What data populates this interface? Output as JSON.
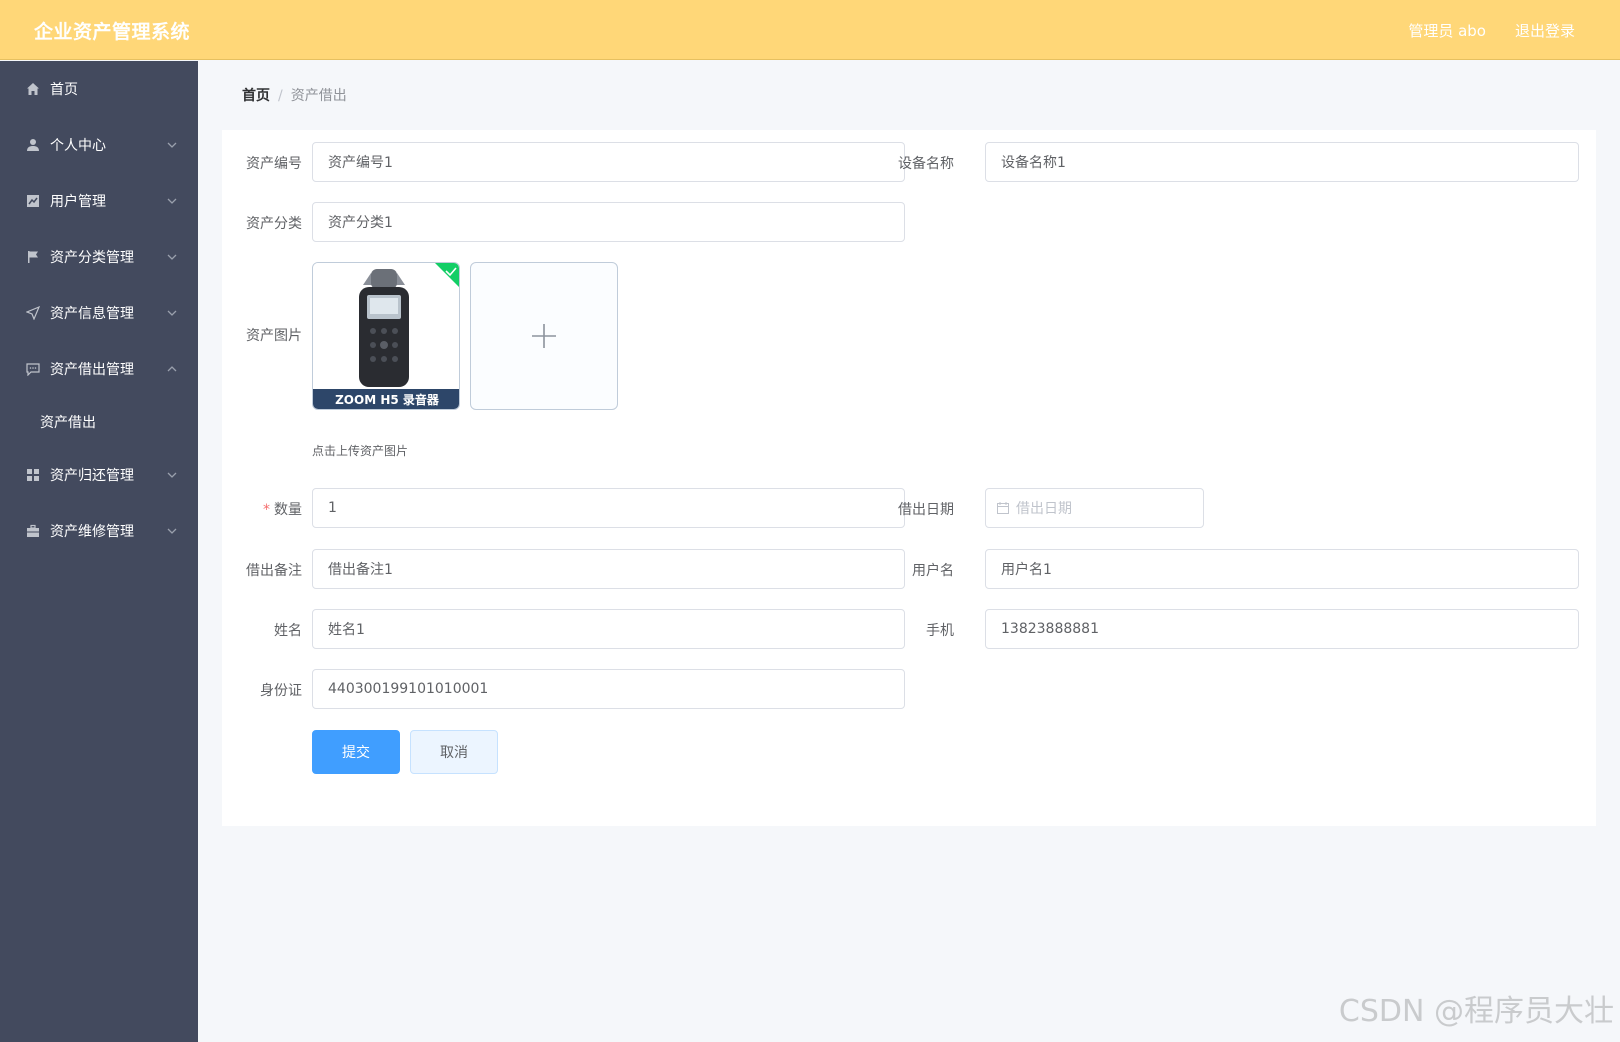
{
  "header": {
    "title": "企业资产管理系统",
    "user": "管理员 abo",
    "logout": "退出登录"
  },
  "sidebar": {
    "items": [
      {
        "label": "首页",
        "icon": "home-icon",
        "expandable": false
      },
      {
        "label": "个人中心",
        "icon": "user-icon",
        "expandable": true
      },
      {
        "label": "用户管理",
        "icon": "chart-icon",
        "expandable": true
      },
      {
        "label": "资产分类管理",
        "icon": "flag-icon",
        "expandable": true
      },
      {
        "label": "资产信息管理",
        "icon": "send-icon",
        "expandable": true
      },
      {
        "label": "资产借出管理",
        "icon": "message-icon",
        "expandable": true,
        "expanded": true
      },
      {
        "label": "资产归还管理",
        "icon": "grid-icon",
        "expandable": true
      },
      {
        "label": "资产维修管理",
        "icon": "briefcase-icon",
        "expandable": true
      }
    ],
    "sub_items": {
      "loan": [
        "资产借出"
      ]
    }
  },
  "breadcrumb": {
    "home": "首页",
    "separator": "/",
    "current": "资产借出"
  },
  "form": {
    "asset_no": {
      "label": "资产编号",
      "value": "资产编号1"
    },
    "device_name": {
      "label": "设备名称",
      "value": "设备名称1"
    },
    "asset_category": {
      "label": "资产分类",
      "value": "资产分类1"
    },
    "asset_image": {
      "label": "资产图片",
      "image_caption": "ZOOM H5 录音器",
      "tip": "点击上传资产图片"
    },
    "quantity": {
      "label": "数量",
      "value": "1",
      "required": true
    },
    "loan_date": {
      "label": "借出日期",
      "placeholder": "借出日期"
    },
    "loan_note": {
      "label": "借出备注",
      "value": "借出备注1"
    },
    "username": {
      "label": "用户名",
      "value": "用户名1"
    },
    "name": {
      "label": "姓名",
      "value": "姓名1"
    },
    "phone": {
      "label": "手机",
      "value": "13823888881"
    },
    "id_card": {
      "label": "身份证",
      "value": "440300199101010001"
    },
    "submit": "提交",
    "cancel": "取消"
  },
  "watermark": "CSDN @程序员大壮",
  "colors": {
    "header_bg": "#ffd778",
    "sidebar_bg": "#434a5e",
    "primary": "#409eff",
    "success_badge": "#13ce66"
  }
}
